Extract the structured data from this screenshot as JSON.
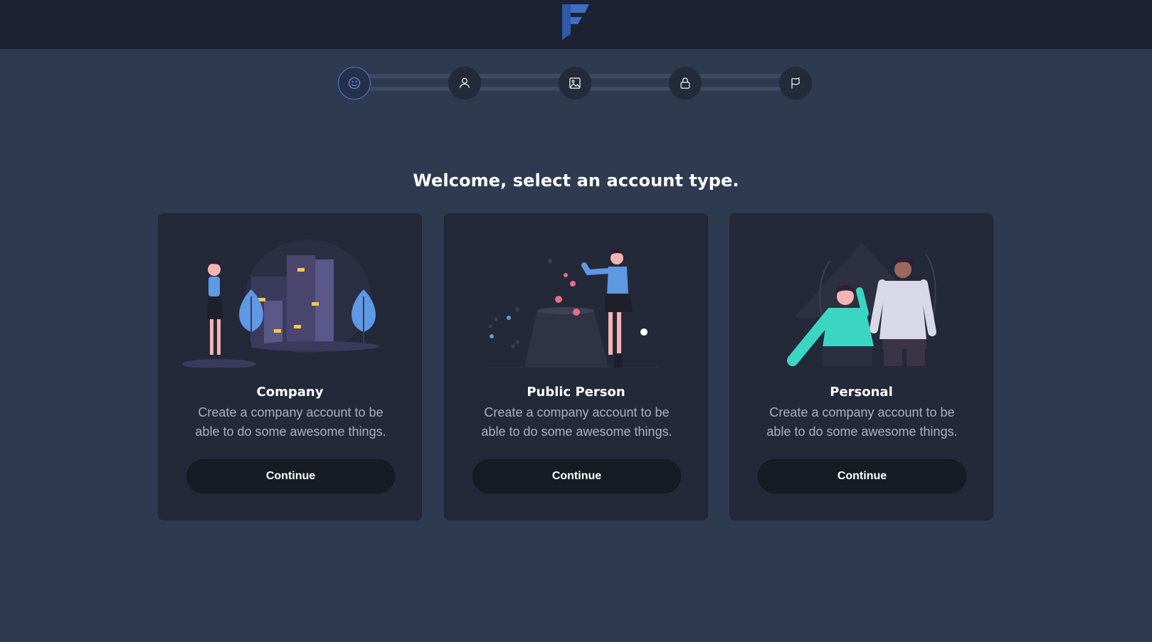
{
  "header": {
    "logo": "F"
  },
  "stepper": {
    "steps": [
      {
        "icon": "smile-icon",
        "active": true
      },
      {
        "icon": "user-icon",
        "active": false
      },
      {
        "icon": "image-icon",
        "active": false
      },
      {
        "icon": "lock-icon",
        "active": false
      },
      {
        "icon": "flag-icon",
        "active": false
      }
    ],
    "active_color": "#4a7fd1"
  },
  "main": {
    "heading": "Welcome, select an account type.",
    "cards": [
      {
        "title": "Company",
        "description": "Create a company account to be able to do some awesome things.",
        "button": "Continue"
      },
      {
        "title": "Public Person",
        "description": "Create a company account to be able to do some awesome things.",
        "button": "Continue"
      },
      {
        "title": "Personal",
        "description": "Create a company account to be able to do some awesome things.",
        "button": "Continue"
      }
    ]
  },
  "colors": {
    "background": "#2e3a50",
    "topbar": "#1c2231",
    "card": "#232939",
    "button": "#171b24",
    "accent": "#4a7fd1"
  }
}
